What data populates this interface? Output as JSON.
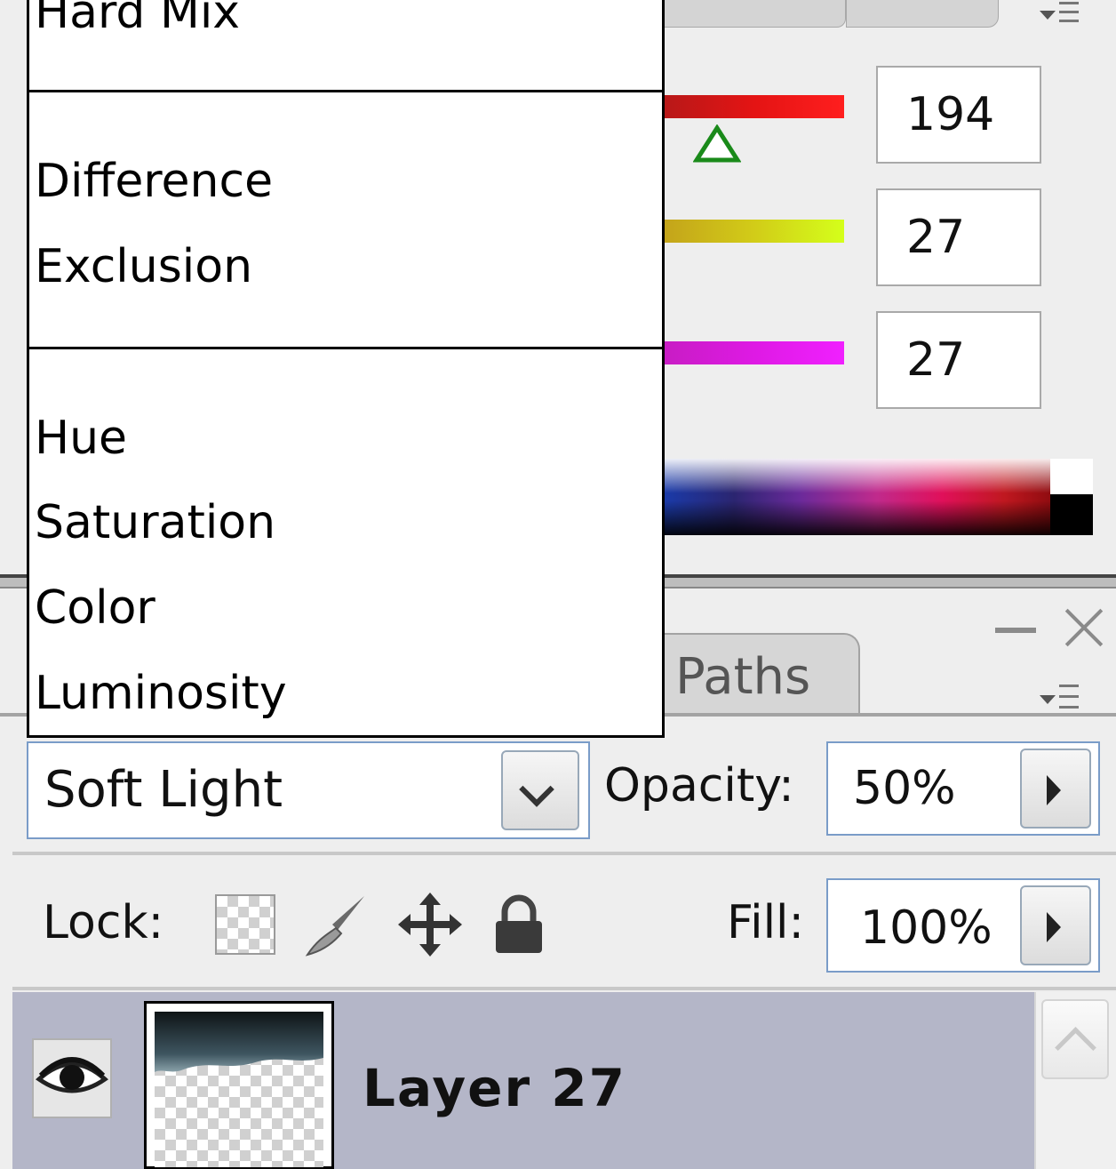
{
  "color_panel": {
    "values": {
      "r": "194",
      "g": "27",
      "b": "27"
    },
    "colors": {
      "r_slider": "#ff1e1e",
      "g_slider": "#d4ff1a",
      "b_slider": "#f020ff"
    }
  },
  "blend_menu": {
    "items": [
      {
        "label": "Hard Mix",
        "partial": true
      },
      {
        "separator": true
      },
      {
        "label": "Difference"
      },
      {
        "label": "Exclusion"
      },
      {
        "separator": true
      },
      {
        "label": "Hue"
      },
      {
        "label": "Saturation"
      },
      {
        "label": "Color"
      },
      {
        "label": "Luminosity"
      }
    ]
  },
  "layers_panel": {
    "tab_paths": "Paths",
    "blend_mode": "Soft Light",
    "opacity_label": "Opacity:",
    "opacity_value": "50%",
    "lock_label": "Lock:",
    "fill_label": "Fill:",
    "fill_value": "100%",
    "layer": {
      "name": "Layer 27",
      "visible": true
    }
  },
  "icons": {
    "menu": "panel-menu-icon",
    "minimize": "minimize-icon",
    "close": "close-icon",
    "lock_transparent": "lock-transparent-icon",
    "lock_image": "brush-icon",
    "lock_position": "move-icon",
    "lock_all": "padlock-icon",
    "visibility": "eye-icon"
  }
}
